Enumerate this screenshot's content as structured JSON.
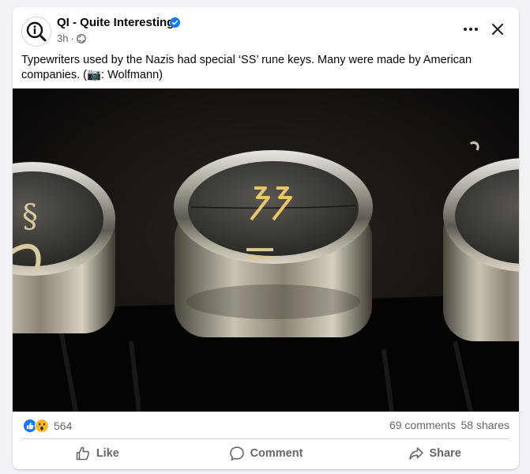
{
  "post": {
    "page_name": "QI - Quite Interesting",
    "verified_icon": "verified-badge-icon",
    "time": "3h",
    "separator": "·",
    "audience_icon": "globe-icon",
    "text": "Typewriters used by the Nazis had special ‘SS’ rune keys. Many were made by American companies. (📷: Wolfmann)"
  },
  "stats": {
    "reactions": [
      "like",
      "wow"
    ],
    "reaction_count": "564",
    "comments": "69 comments",
    "shares": "58 shares"
  },
  "actions": {
    "like": "Like",
    "comment": "Comment",
    "share": "Share"
  },
  "colors": {
    "accent": "#1877f2",
    "secondary_text": "#65676b",
    "background": "#f0f2f5"
  }
}
